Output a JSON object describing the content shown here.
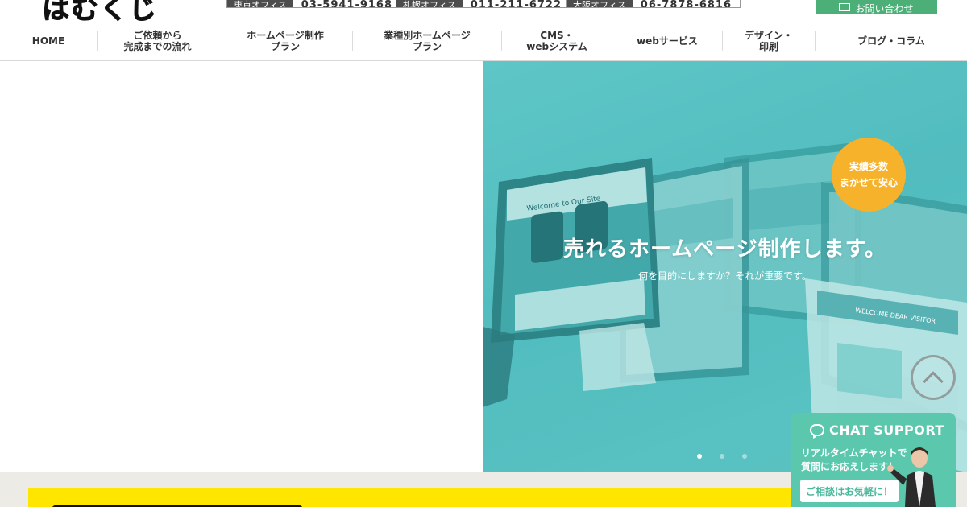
{
  "header": {
    "logo_text": "はむくじ",
    "phones": [
      {
        "label": "東京オフィス",
        "number": "03-5941-9168"
      },
      {
        "label": "札幌オフィス",
        "number": "011-211-6722"
      },
      {
        "label": "大阪オフィス",
        "number": "06-7878-6816"
      }
    ],
    "contact_label": "お問い合わせ"
  },
  "nav": {
    "items": [
      {
        "label": "HOME"
      },
      {
        "label": "ご依頼から\n完成までの流れ"
      },
      {
        "label": "ホームページ制作\nプラン"
      },
      {
        "label": "業種別ホームページ\nプラン"
      },
      {
        "label": "CMS・\nwebシステム"
      },
      {
        "label": "webサービス"
      },
      {
        "label": "デザイン・\n印刷"
      },
      {
        "label": "ブログ・コラム"
      }
    ]
  },
  "hero": {
    "title": "売れるホームページ制作します。",
    "subtitle": "何を目的にしますか？それが重要です。",
    "badge_line1": "実績多数",
    "badge_line2": "まかせて安心",
    "screen_caption_1": "Welcome to Our Site",
    "screen_caption_2": "WELCOME DEAR VISITOR",
    "slide_count": 3,
    "active_slide": 1
  },
  "chat": {
    "title": "CHAT SUPPORT",
    "message": "リアルタイムチャットで\n質問にお応えします！",
    "button_label": "ご相談はお気軽に！"
  },
  "colors": {
    "hero_teal": "#58c1c3",
    "badge_orange": "#f7b22c",
    "chat_green": "#5bc7ad",
    "contact_green": "#4caf78",
    "yellow_band": "#ffe600"
  }
}
